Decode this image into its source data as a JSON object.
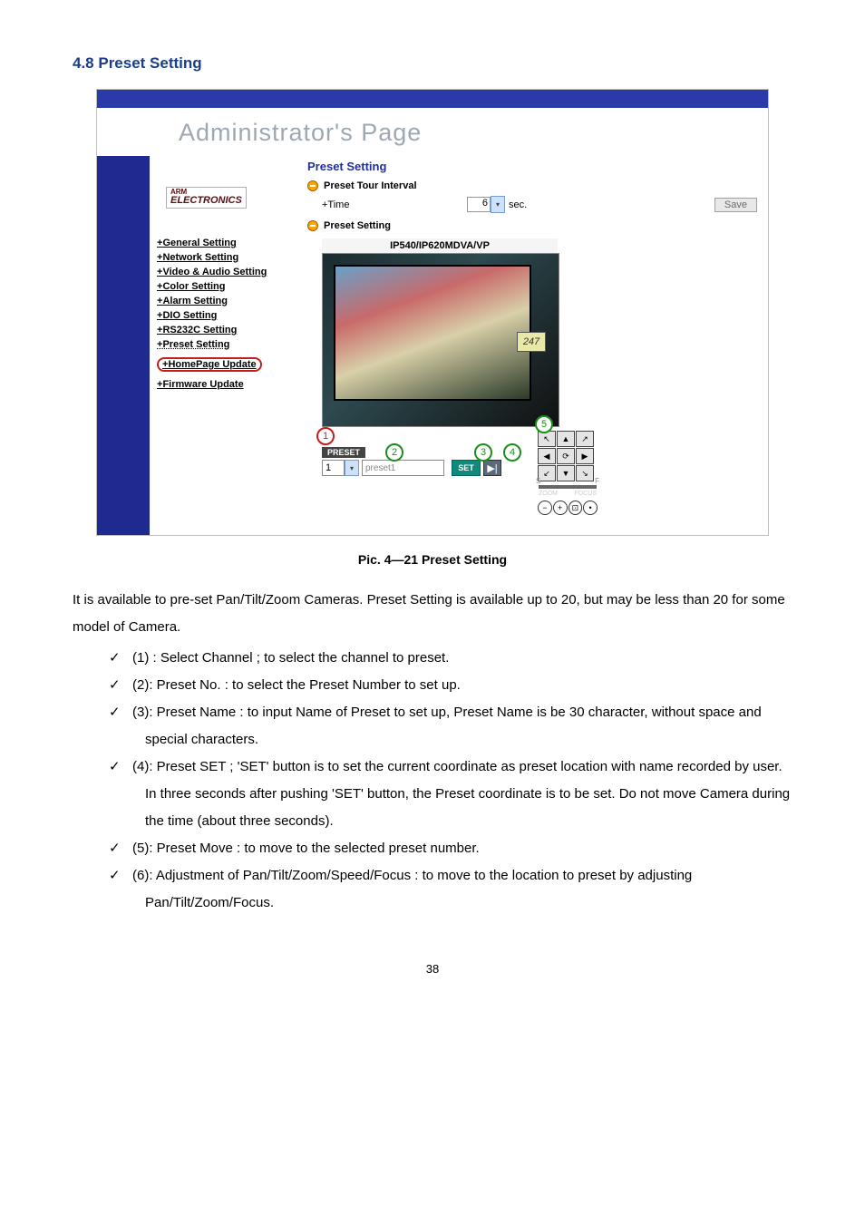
{
  "section_title": "4.8 Preset Setting",
  "screenshot": {
    "header_title": "Administrator's Page",
    "brand_top": "ARM",
    "brand_bottom": "ELECTRONICS",
    "nav": [
      "General Setting",
      "Network Setting",
      "Video & Audio Setting",
      "Color Setting",
      "Alarm Setting",
      "DIO Setting",
      "RS232C Setting",
      "Preset Setting",
      "HomePage Update",
      "Firmware Update"
    ],
    "panel_title": "Preset Setting",
    "row1_label": "Preset Tour Interval",
    "time_label": "+Time",
    "time_value": "6",
    "sec_label": "sec.",
    "save_label": "Save",
    "row2_label": "Preset Setting",
    "preview_title": "IP540/IP620MDVA/VP",
    "clock_value": "247",
    "preset_badge": "PRESET",
    "channel_value": "1",
    "preset_name_placeholder": "preset1",
    "set_label": "SET",
    "move_label": "▶|",
    "callouts": {
      "c1": "1",
      "c2": "2",
      "c3": "3",
      "c4": "4",
      "c5": "5"
    },
    "joypad_arrows": [
      "↖",
      "▲",
      "↗",
      "◀",
      "⟳",
      "▶",
      "↙",
      "▼",
      "↘"
    ],
    "zoom_label_l": "ZOOM",
    "zoom_label_r": "FOCUS",
    "zbtns": [
      "−",
      "+",
      "⊡",
      "•"
    ]
  },
  "caption": "Pic. 4—21    Preset Setting",
  "intro": "It is available to pre-set Pan/Tilt/Zoom Cameras. Preset Setting is available up to 20, but may be less than 20 for some model of Camera.",
  "bullets": [
    "(1) : Select Channel ; to select the channel to preset.",
    "(2): Preset No. : to select the Preset Number to set up.",
    "(3): Preset Name : to input Name of Preset to set up, Preset Name is be 30 character, without space and special characters.",
    "(4): Preset SET ; 'SET' button is to set the current coordinate as preset location with name recorded by user. In three seconds after pushing 'SET' button, the Preset coordinate is to be set. Do not move Camera during the time (about three seconds).",
    "(5): Preset Move : to move to the selected preset number.",
    "(6): Adjustment of Pan/Tilt/Zoom/Speed/Focus : to move to the location to preset by adjusting Pan/Tilt/Zoom/Focus."
  ],
  "page_number": "38"
}
